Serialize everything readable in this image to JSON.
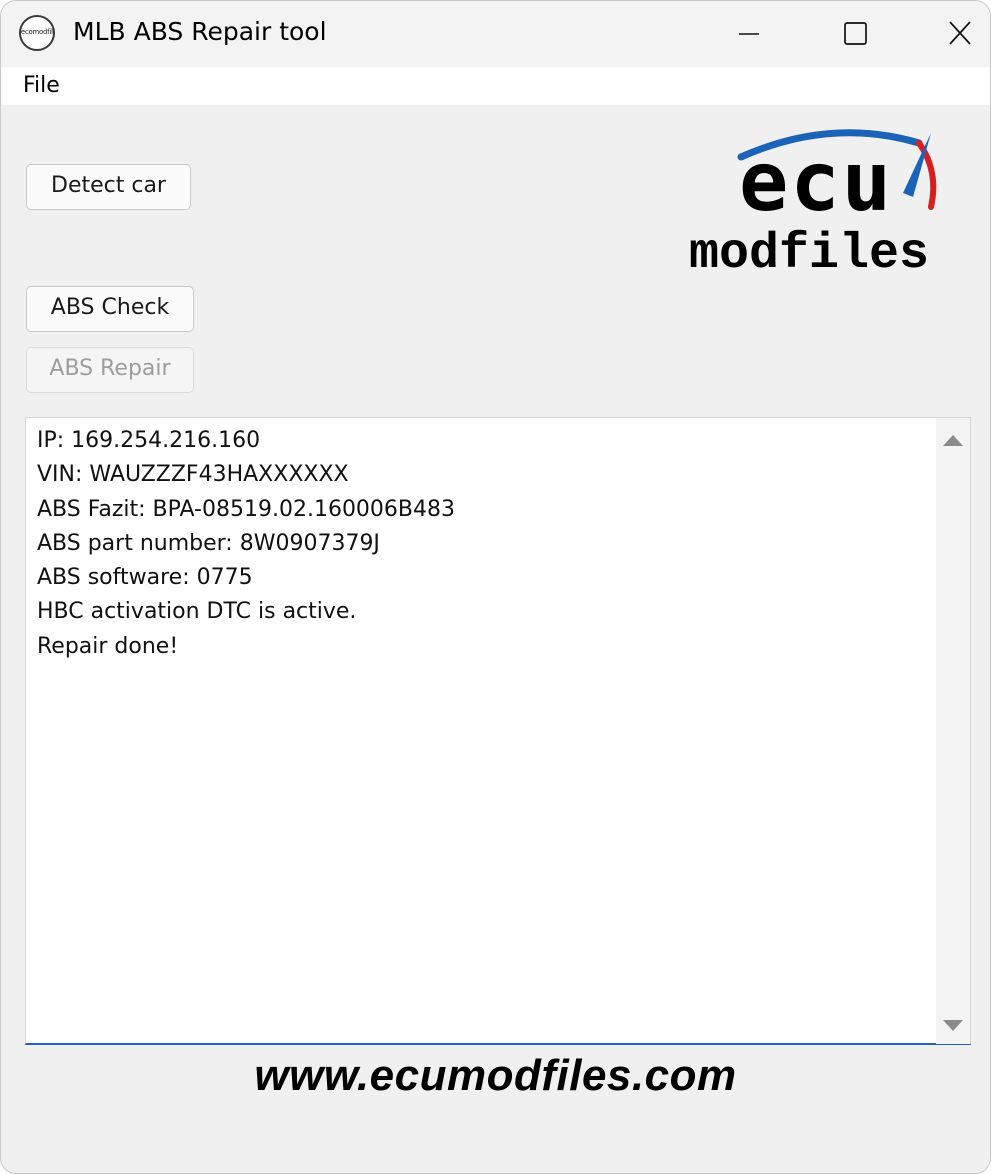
{
  "window": {
    "title": "MLB ABS Repair tool",
    "icon_label": "ecomodfiles",
    "controls": {
      "minimize_icon": "minimize-icon",
      "maximize_icon": "maximize-icon",
      "close_icon": "close-icon"
    }
  },
  "menu": {
    "items": [
      {
        "label": "File"
      }
    ]
  },
  "buttons": {
    "detect_car": "Detect car",
    "abs_check": "ABS Check",
    "abs_repair": "ABS Repair"
  },
  "logo": {
    "line1": "ecu",
    "line2": "modfiles",
    "accent_blue": "#1b63b8",
    "accent_red": "#d6201f"
  },
  "log": {
    "lines": [
      "IP: 169.254.216.160",
      "VIN: WAUZZZF43HAXXXXXX",
      "ABS Fazit: BPA-08519.02.160006B483",
      "ABS part number: 8W0907379J",
      "ABS software: 0775",
      "HBC activation DTC is active.",
      "Repair done!"
    ]
  },
  "footer": {
    "url": "www.ecumodfiles.com"
  },
  "colors": {
    "focus_underline": "#1f62c4",
    "window_bg": "#f0f0f0",
    "disabled_text": "#9d9d9d"
  }
}
